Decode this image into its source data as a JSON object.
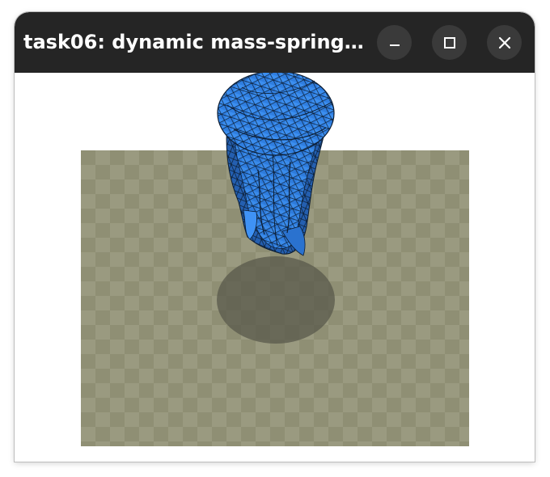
{
  "window": {
    "title": "task06: dynamic mass-spring…"
  },
  "controls": {
    "minimize_icon": "minimize-icon",
    "maximize_icon": "maximize-icon",
    "close_icon": "close-icon"
  },
  "scene": {
    "floor_color_a": "#8f8f74",
    "floor_color_b": "#9a9a80",
    "shadow_color": "#5b5b4d",
    "cloth_color": "#2f7ee0",
    "cloth_edge_color": "#0c1d33"
  }
}
